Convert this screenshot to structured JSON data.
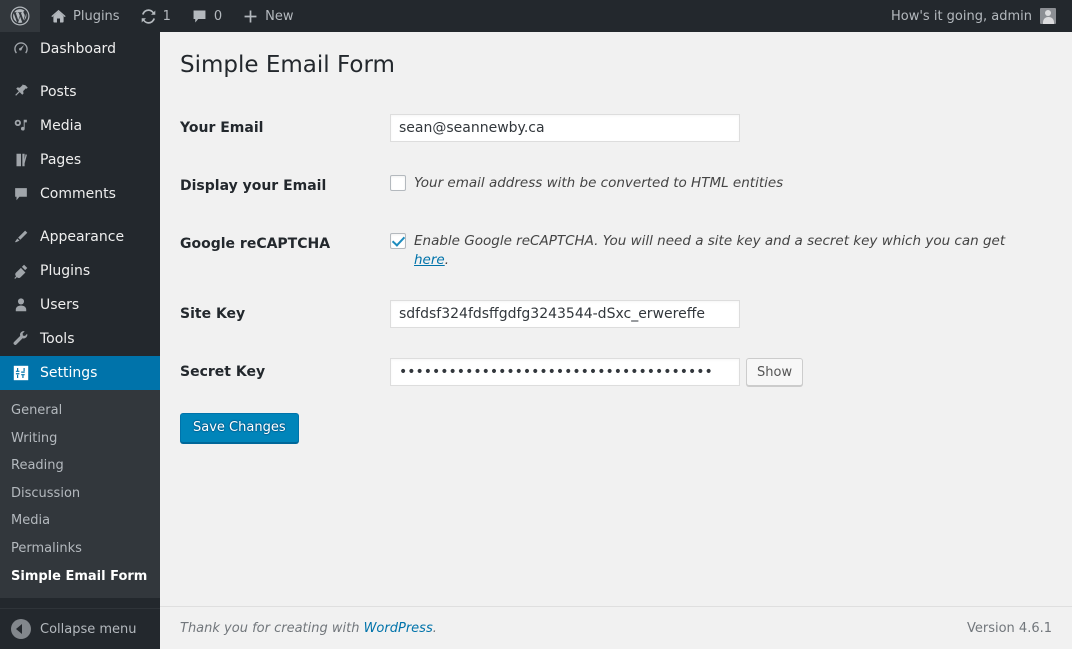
{
  "adminbar": {
    "logo_icon": "wordpress-logo-icon",
    "items": [
      {
        "icon": "home-icon",
        "label": "Plugins",
        "name": "site-name"
      },
      {
        "icon": "updates-icon",
        "label": "1",
        "name": "updates"
      },
      {
        "icon": "comment-icon",
        "label": "0",
        "name": "comments"
      },
      {
        "icon": "plus-icon",
        "label": "New",
        "name": "new-content"
      }
    ],
    "howdy": "How's it going, admin",
    "avatar_icon": "avatar-icon"
  },
  "sidebar": {
    "items": [
      {
        "label": "Dashboard",
        "icon": "dashboard-icon",
        "current": false,
        "sep_after": true
      },
      {
        "label": "Posts",
        "icon": "pin-icon",
        "current": false,
        "sep_after": false
      },
      {
        "label": "Media",
        "icon": "media-icon",
        "current": false,
        "sep_after": false
      },
      {
        "label": "Pages",
        "icon": "pages-icon",
        "current": false,
        "sep_after": false
      },
      {
        "label": "Comments",
        "icon": "comment-icon",
        "current": false,
        "sep_after": true
      },
      {
        "label": "Appearance",
        "icon": "appearance-icon",
        "current": false,
        "sep_after": false
      },
      {
        "label": "Plugins",
        "icon": "plugins-icon",
        "current": false,
        "sep_after": false
      },
      {
        "label": "Users",
        "icon": "users-icon",
        "current": false,
        "sep_after": false
      },
      {
        "label": "Tools",
        "icon": "tools-icon",
        "current": false,
        "sep_after": false
      },
      {
        "label": "Settings",
        "icon": "settings-icon",
        "current": true,
        "sep_after": false
      }
    ],
    "submenu": [
      {
        "label": "General",
        "current": false
      },
      {
        "label": "Writing",
        "current": false
      },
      {
        "label": "Reading",
        "current": false
      },
      {
        "label": "Discussion",
        "current": false
      },
      {
        "label": "Media",
        "current": false
      },
      {
        "label": "Permalinks",
        "current": false
      },
      {
        "label": "Simple Email Form",
        "current": true
      }
    ],
    "collapse_label": "Collapse menu",
    "collapse_icon": "collapse-arrow-icon"
  },
  "page": {
    "title": "Simple Email Form",
    "rows": {
      "your_email": {
        "label": "Your Email",
        "value": "sean@seannewby.ca",
        "placeholder": ""
      },
      "display_email": {
        "label": "Display your Email",
        "checked": false,
        "description": "Your email address with be converted to HTML entities"
      },
      "recaptcha": {
        "label": "Google reCAPTCHA",
        "checked": true,
        "description_before": "Enable Google reCAPTCHA. You will need a site key and a secret key which you can get ",
        "link_text": "here",
        "description_after": "."
      },
      "site_key": {
        "label": "Site Key",
        "value": "sdfdsf324fdsffgdfg3243544-dSxc_erwereffe",
        "placeholder": ""
      },
      "secret_key": {
        "label": "Secret Key",
        "value": "••••••••••••••••••••••••••••••••••••••",
        "placeholder": "",
        "show_label": "Show"
      }
    },
    "submit_label": "Save Changes"
  },
  "footer": {
    "thanks_before": "Thank you for creating with ",
    "thanks_link": "WordPress",
    "thanks_after": ".",
    "version": "Version 4.6.1"
  },
  "colors": {
    "admin_bar_bg": "#23282d",
    "sidebar_bg": "#23282d",
    "submenu_bg": "#32373c",
    "accent": "#0073aa",
    "primary_button": "#0085ba",
    "content_bg": "#f1f1f1",
    "link": "#0073aa"
  }
}
